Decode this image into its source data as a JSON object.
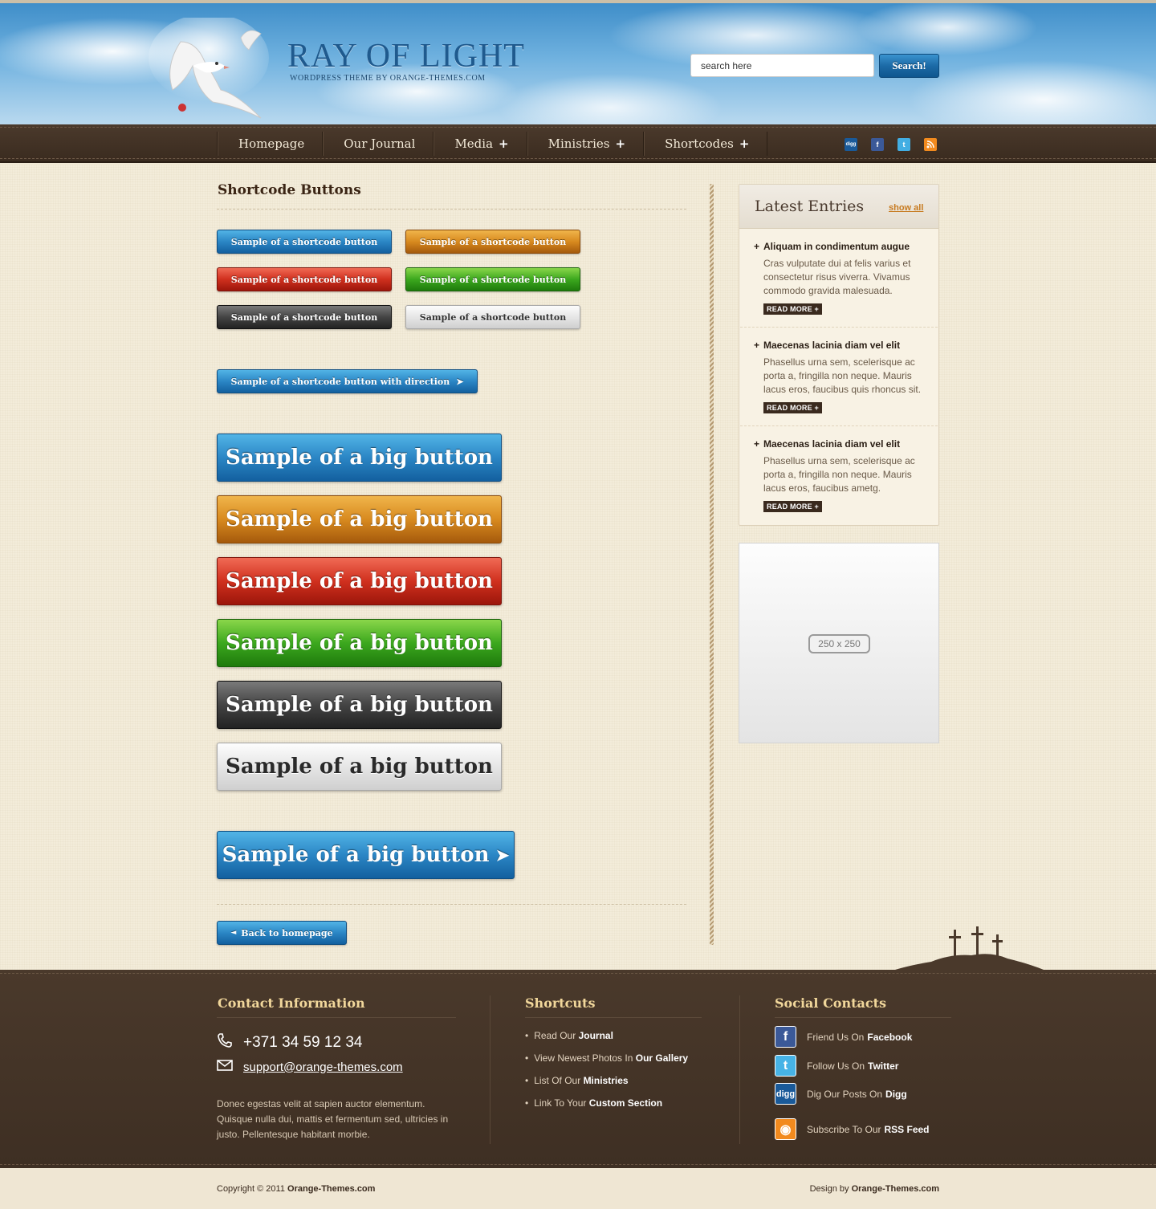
{
  "header": {
    "logo_title": "RAY OF LIGHT",
    "logo_subtitle": "WORDPRESS THEME BY ORANGE-THEMES.COM",
    "search_placeholder": "search here",
    "search_value": "search here",
    "search_button": "Search!"
  },
  "nav": {
    "items": [
      {
        "label": "Homepage",
        "has_submenu": false
      },
      {
        "label": "Our Journal",
        "has_submenu": false
      },
      {
        "label": "Media",
        "has_submenu": true
      },
      {
        "label": "Ministries",
        "has_submenu": true
      },
      {
        "label": "Shortcodes",
        "has_submenu": true
      }
    ],
    "submenu_glyph": "+",
    "social_icons": [
      "digg-icon",
      "facebook-icon",
      "twitter-icon",
      "rss-icon"
    ]
  },
  "main": {
    "title": "Shortcode Buttons",
    "small_buttons": [
      {
        "label": "Sample of a shortcode button",
        "color": "blue"
      },
      {
        "label": "Sample of a shortcode button",
        "color": "orange"
      },
      {
        "label": "Sample of a shortcode button",
        "color": "red"
      },
      {
        "label": "Sample of a shortcode button",
        "color": "green"
      },
      {
        "label": "Sample of a shortcode button",
        "color": "dark"
      },
      {
        "label": "Sample of a shortcode button",
        "color": "light"
      }
    ],
    "direction_button": {
      "label": "Sample of a shortcode button with direction",
      "arrow": "➤"
    },
    "big_buttons": [
      {
        "label": "Sample of a big button",
        "color": "blue"
      },
      {
        "label": "Sample of a big button",
        "color": "orange"
      },
      {
        "label": "Sample of a big button",
        "color": "red"
      },
      {
        "label": "Sample of a big button",
        "color": "green"
      },
      {
        "label": "Sample of a big button",
        "color": "dark"
      },
      {
        "label": "Sample of a big button",
        "color": "light"
      }
    ],
    "big_direction_button": {
      "label": "Sample of a big button",
      "arrow": "➤"
    },
    "back_button": {
      "label": "Back to homepage",
      "arrow": "◄"
    }
  },
  "sidebar": {
    "widget_title": "Latest Entries",
    "show_all": "show all",
    "entries": [
      {
        "title": "Aliquam in condimentum augue",
        "body": "Cras vulputate dui at felis varius et consectetur risus viverra. Vivamus commodo gravida malesuada.",
        "read_more": "READ MORE +"
      },
      {
        "title": "Maecenas lacinia diam vel elit",
        "body": "Phasellus urna sem, scelerisque ac porta a, fringilla non neque. Mauris lacus eros, faucibus quis rhoncus sit.",
        "read_more": "READ MORE +"
      },
      {
        "title": "Maecenas lacinia diam vel elit",
        "body": "Phasellus urna sem, scelerisque ac porta a, fringilla non neque. Mauris lacus eros, faucibus ametg.",
        "read_more": "READ MORE +"
      }
    ],
    "ad_label": "250 x 250"
  },
  "footer": {
    "contact": {
      "title": "Contact Information",
      "phone": "+371 34 59 12 34",
      "email": "support@orange-themes.com",
      "description": "Donec egestas velit at sapien auctor elementum. Quisque nulla dui, mattis et fermentum sed, ultricies in justo. Pellentesque habitant morbie."
    },
    "shortcuts": {
      "title": "Shortcuts",
      "items": [
        {
          "text": "Read Our",
          "bold": "Journal"
        },
        {
          "text": "View Newest Photos In",
          "bold": "Our Gallery"
        },
        {
          "text": "List Of Our",
          "bold": "Ministries"
        },
        {
          "text": "Link To Your",
          "bold": "Custom Section"
        }
      ]
    },
    "social": {
      "title": "Social Contacts",
      "items": [
        {
          "icon": "facebook-icon",
          "glyph": "f",
          "text": "Friend Us On",
          "bold": "Facebook"
        },
        {
          "icon": "twitter-icon",
          "glyph": "t",
          "text": "Follow Us On",
          "bold": "Twitter"
        },
        {
          "icon": "digg-icon",
          "glyph": "digg",
          "text": "Dig Our Posts On",
          "bold": "Digg"
        },
        {
          "icon": "rss-icon",
          "glyph": "◉",
          "text": "Subscribe To Our",
          "bold": "RSS Feed"
        }
      ]
    },
    "copyright_prefix": "Copyright © 2011",
    "copyright_bold": "Orange-Themes.com",
    "design_prefix": "Design by",
    "design_bold": "Orange-Themes.com"
  },
  "colors": {
    "nav_bg": "#3a2b1f",
    "footer_bg": "#3e2f23",
    "accent_link": "#c77a20",
    "footer_heading": "#f1d79b"
  }
}
